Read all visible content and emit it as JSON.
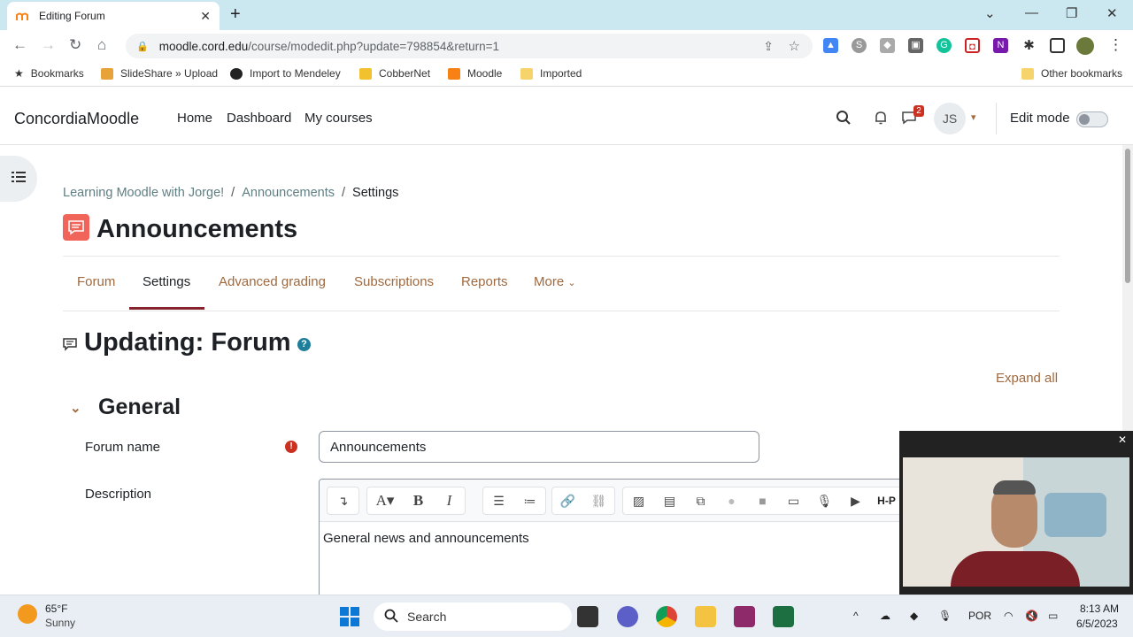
{
  "browser": {
    "tab_title": "Editing Forum",
    "url_host": "moodle.cord.edu",
    "url_path": "/course/modedit.php?update=798854&return=1",
    "bookmarks": [
      "Bookmarks",
      "SlideShare » Upload",
      "Import to Mendeley",
      "CobberNet",
      "Moodle",
      "Imported"
    ],
    "other_bookmarks": "Other bookmarks"
  },
  "moodle_nav": {
    "brand": "ConcordiaMoodle",
    "links": [
      "Home",
      "Dashboard",
      "My courses"
    ],
    "message_badge": "2",
    "user_initials": "JS",
    "edit_mode_label": "Edit mode"
  },
  "breadcrumb": {
    "items": [
      "Learning Moodle with Jorge!",
      "Announcements",
      "Settings"
    ],
    "separator": "/"
  },
  "page": {
    "title": "Announcements"
  },
  "secondary_nav": {
    "items": [
      "Forum",
      "Settings",
      "Advanced grading",
      "Subscriptions",
      "Reports",
      "More"
    ],
    "active": "Settings"
  },
  "form": {
    "heading": "Updating: Forum",
    "expand_all": "Expand all",
    "section_general": "General",
    "forum_name_label": "Forum name",
    "forum_name_value": "Announcements",
    "description_label": "Description",
    "description_text": "General news and announcements"
  },
  "taskbar": {
    "weather_temp": "65°F",
    "weather_desc": "Sunny",
    "search_label": "Search",
    "language": "POR",
    "time": "8:13 AM",
    "date": "6/5/2023"
  },
  "colors": {
    "accent_link": "#a0693e",
    "active_tab_underline": "#87232d",
    "forum_icon": "#f0645a"
  }
}
